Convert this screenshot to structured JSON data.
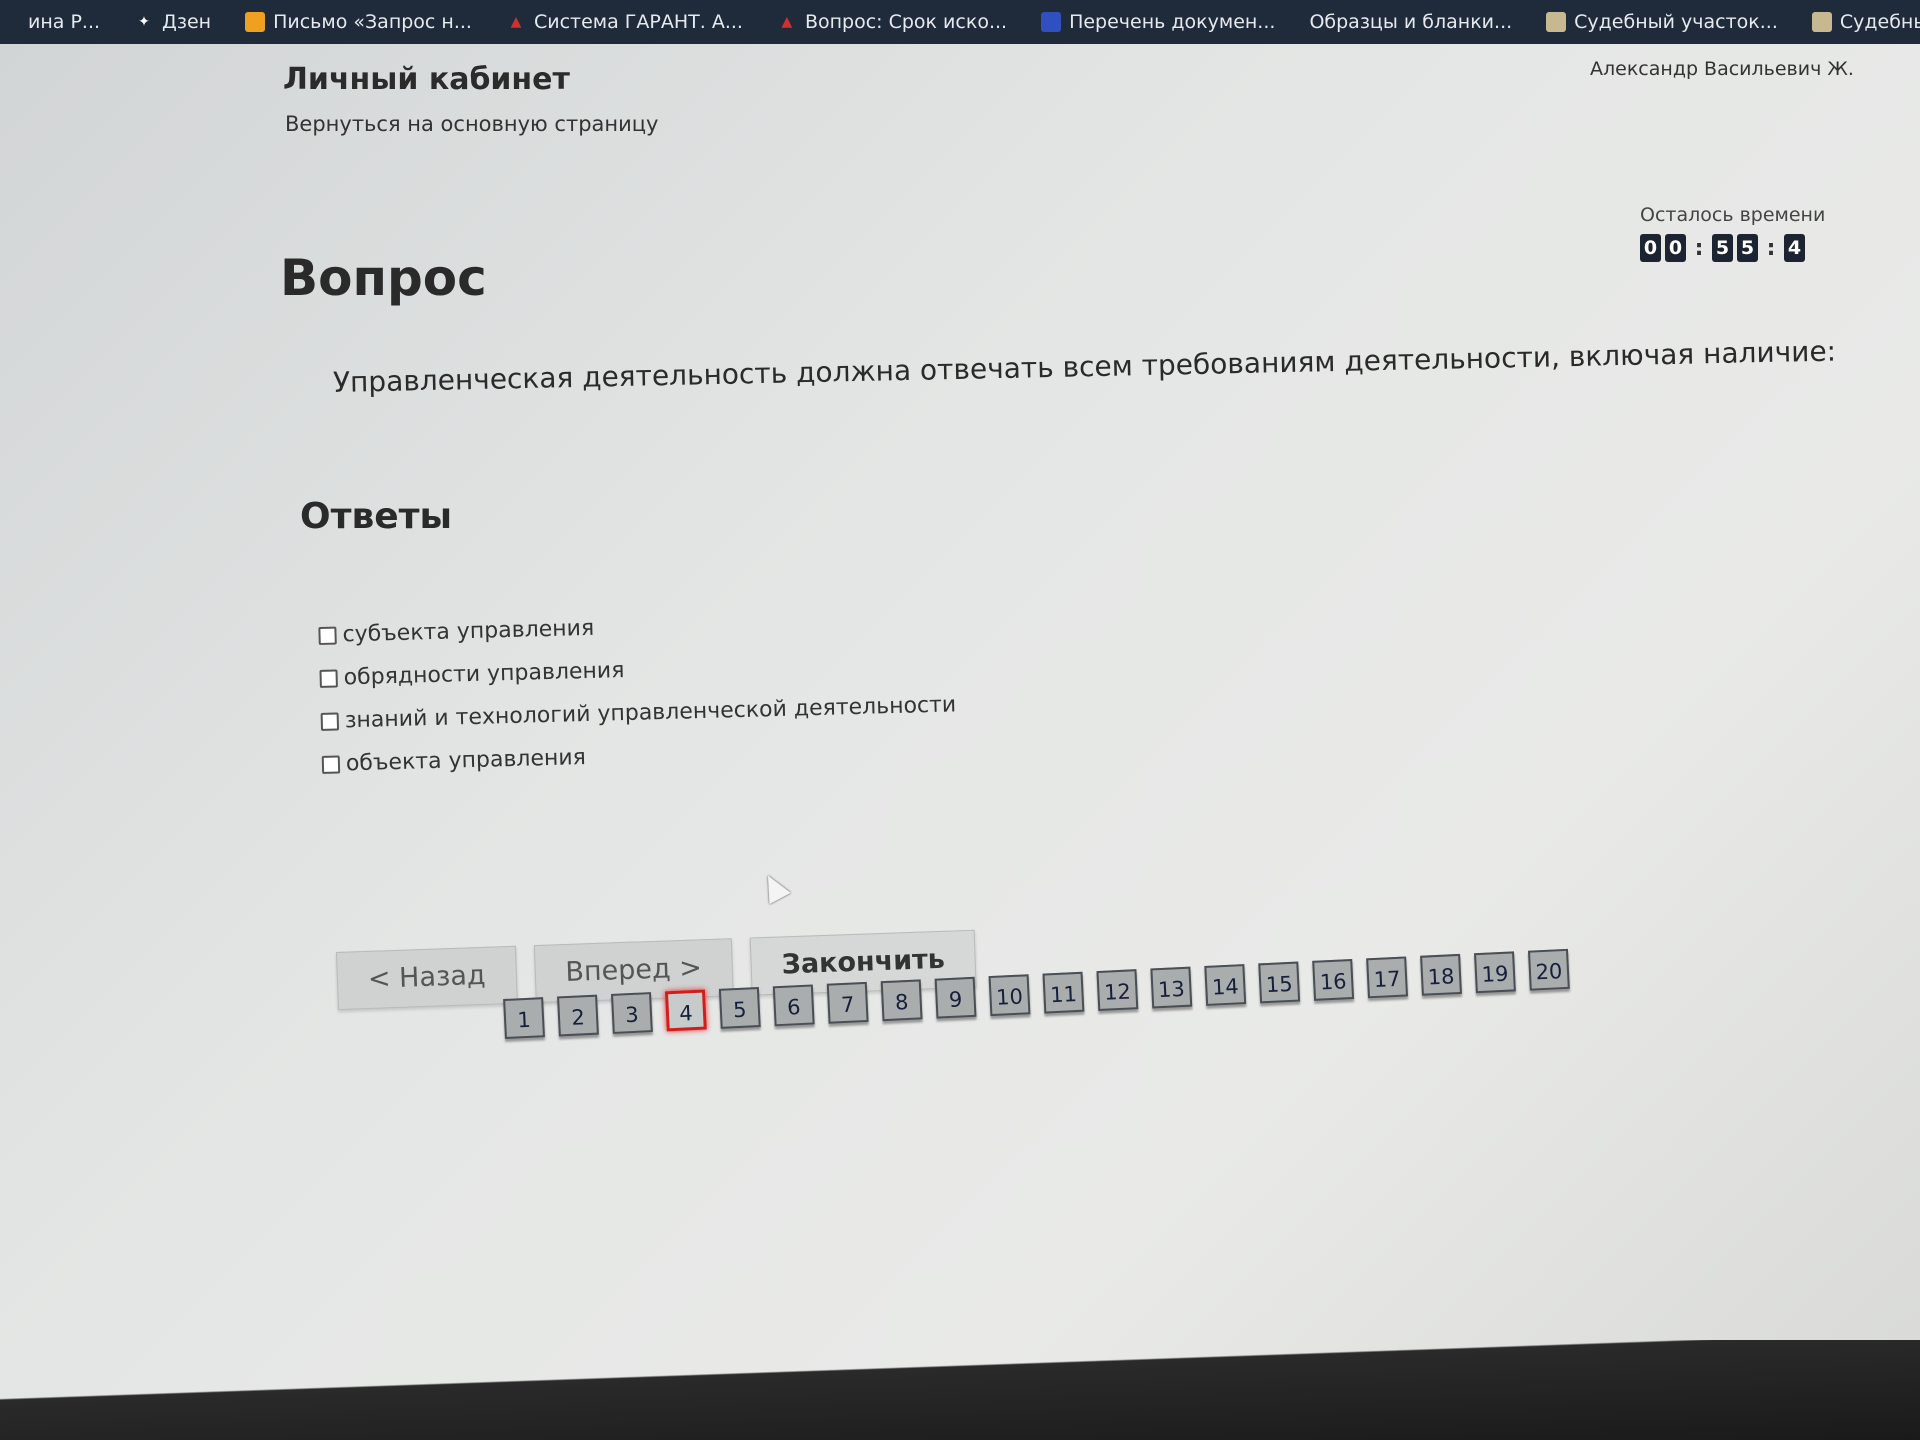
{
  "bookmarks": [
    {
      "label": "ина Р...",
      "icon": "bookmark-icon",
      "color": "#c04040"
    },
    {
      "label": "Дзен",
      "icon": "dzen-icon",
      "color": "#222222"
    },
    {
      "label": "Письмо «Запрос н...",
      "icon": "mail-icon",
      "color": "#f0a020"
    },
    {
      "label": "Система ГАРАНТ. А...",
      "icon": "garant-icon",
      "color": "#c02020"
    },
    {
      "label": "Вопрос: Срок иско...",
      "icon": "question-icon",
      "color": "#c02020"
    },
    {
      "label": "Перечень докумен...",
      "icon": "doc-icon",
      "color": "#3050c0"
    },
    {
      "label": "Образцы и бланки...",
      "icon": "blank-icon",
      "color": "#1f2a3a"
    },
    {
      "label": "Судебный участок...",
      "icon": "court-icon",
      "color": "#c8b890"
    },
    {
      "label": "Судебный участок...",
      "icon": "court-icon",
      "color": "#c8b890"
    }
  ],
  "header": {
    "title": "Личный кабинет",
    "back_link": "Вернуться на основную страницу",
    "user": "Александр Васильевич Ж."
  },
  "timer": {
    "label": "Осталось времени",
    "digits": [
      "0",
      "0",
      "5",
      "5",
      "4"
    ]
  },
  "question": {
    "heading": "Вопрос",
    "text": "Управленческая деятельность должна отвечать всем требованиям деятельности, включая наличие:"
  },
  "answers": {
    "heading": "Ответы",
    "options": [
      "субъекта управления",
      "обрядности управления",
      "знаний и технологий управленческой деятельности",
      "объекта управления"
    ]
  },
  "nav": {
    "back": "< Назад",
    "forward": "Вперед >",
    "finish": "Закончить"
  },
  "pager": {
    "pages": [
      "1",
      "2",
      "3",
      "4",
      "5",
      "6",
      "7",
      "8",
      "9",
      "10",
      "11",
      "12",
      "13",
      "14",
      "15",
      "16",
      "17",
      "18",
      "19",
      "20"
    ],
    "current": "4"
  }
}
